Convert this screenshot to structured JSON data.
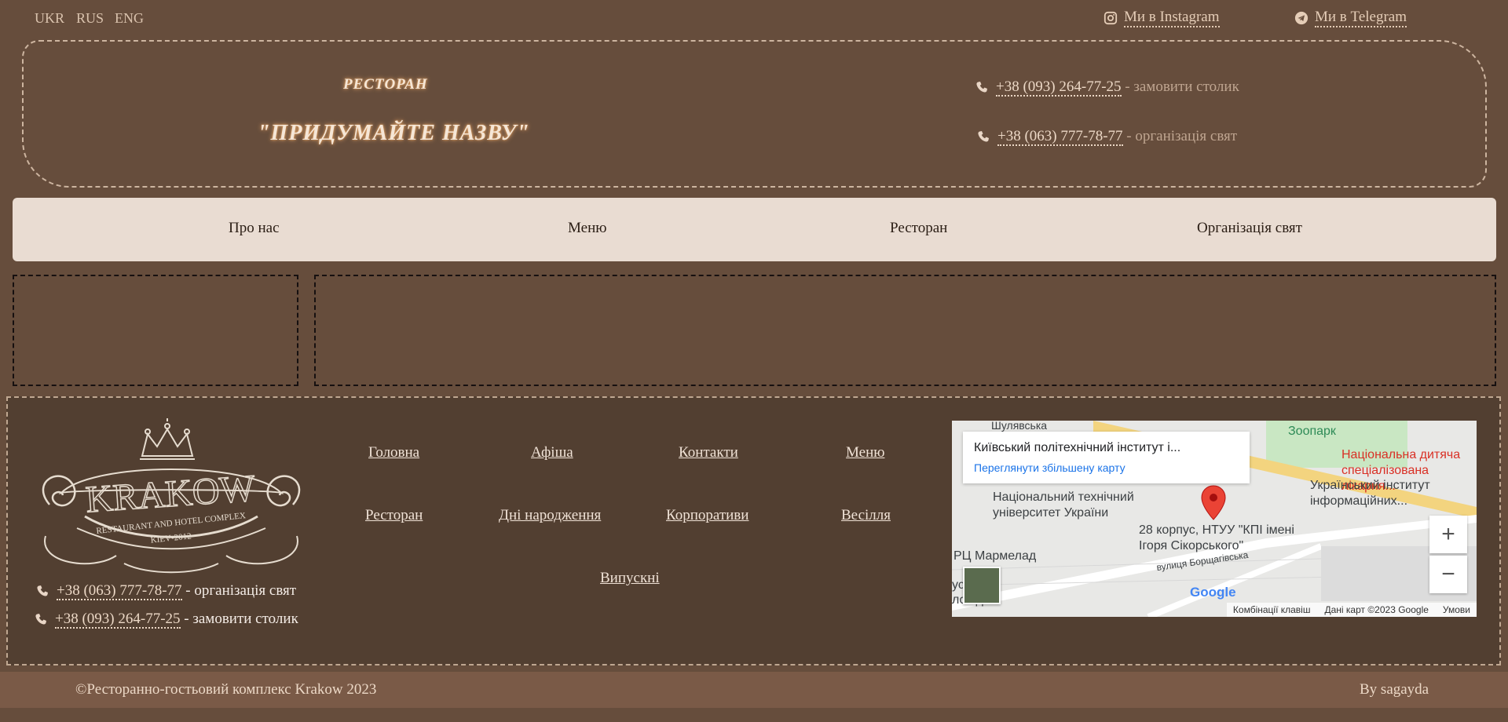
{
  "top": {
    "langs": [
      "UKR",
      "RUS",
      "ENG"
    ],
    "instagram": "Ми в Instagram",
    "telegram": "Ми в Telegram"
  },
  "header": {
    "label": "РЕСТОРАН",
    "name": "\"ПРИДУМАЙТЕ НАЗВУ\"",
    "phone1": "+38 (093) 264-77-25",
    "phone1_desc": " - замовити столик",
    "phone2": "+38 (063) 777-78-77",
    "phone2_desc": " - організація свят"
  },
  "nav": [
    "Про нас",
    "Меню",
    "Ресторан",
    "Організація свят"
  ],
  "footer": {
    "logo": {
      "title": "KRAKOW",
      "subtitle": "RESTAURANT AND HOTEL COMPLEX",
      "city": "KIEV•2012"
    },
    "links": [
      "Головна",
      "Афіша",
      "Контакти",
      "Меню",
      "Ресторан",
      "Дні народження",
      "Корпоративи",
      "Весілля",
      "Випускні"
    ],
    "phone1": "+38 (063) 777-78-77",
    "phone1_desc": " - організація свят",
    "phone2": "+38 (093) 264-77-25",
    "phone2_desc": " - замовити столик"
  },
  "map": {
    "card_title": "Київський політехнічний інститут і...",
    "card_link": "Переглянути збільшену карту",
    "labels": {
      "zoo": "Зоопарк",
      "shulyavska": "Шулявська",
      "hospital": "Національна дитяча спеціалізована лікарня...",
      "ntuu": "Національний технічний університет України",
      "korpus": "28 корпус, НТУУ \"КПІ імені Ігоря Сікорського\"",
      "uiit": "Український інститут інформаційних...",
      "rc": "РЦ Мармелад",
      "street": "вулиця Борщагівська",
      "left1": "усний",
      "left2": "ловід"
    },
    "google": "Google",
    "attr1": "Комбінації клавіш",
    "attr2": "Дані карт ©2023 Google",
    "attr3": "Умови"
  },
  "copyright": {
    "left": "©Ресторанно-гостьовий комплекс Krakow 2023",
    "right": "By sagayda"
  }
}
